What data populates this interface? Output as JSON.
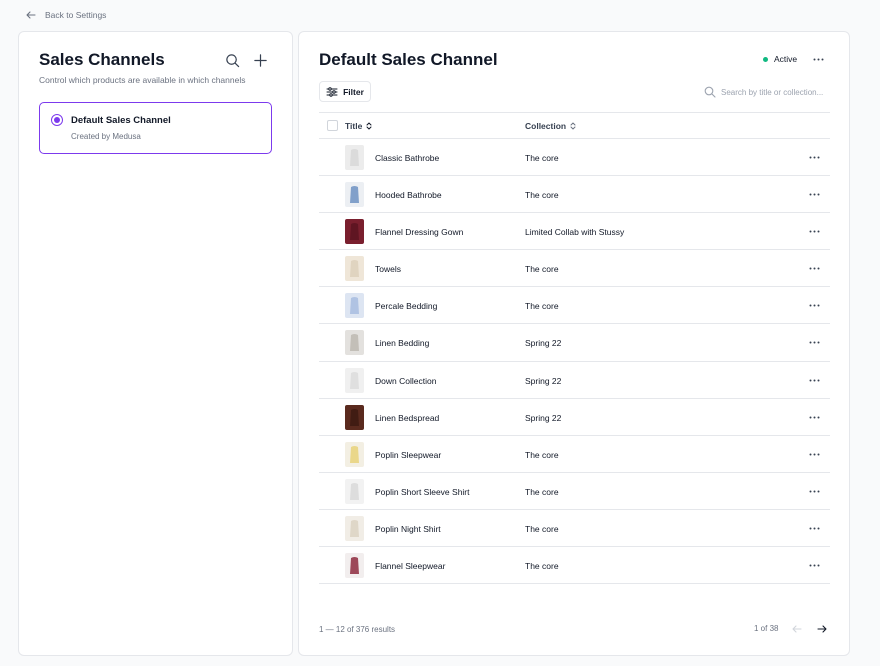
{
  "back_link": {
    "label": "Back to Settings"
  },
  "sidebar": {
    "title": "Sales Channels",
    "subtitle": "Control which products are available in which channels",
    "channels": [
      {
        "name": "Default Sales Channel",
        "meta": "Created by Medusa",
        "selected": true
      }
    ]
  },
  "main": {
    "title": "Default Sales Channel",
    "status": "Active",
    "filter_label": "Filter",
    "search_placeholder": "Search by title or collection...",
    "columns": {
      "title": "Title",
      "collection": "Collection"
    },
    "rows": [
      {
        "title": "Classic Bathrobe",
        "collection": "The core",
        "thumb": "white-robe"
      },
      {
        "title": "Hooded Bathrobe",
        "collection": "The core",
        "thumb": "blue-robe"
      },
      {
        "title": "Flannel Dressing Gown",
        "collection": "Limited Collab with Stussy",
        "thumb": "burgundy-gown"
      },
      {
        "title": "Towels",
        "collection": "The core",
        "thumb": "beige-towels"
      },
      {
        "title": "Percale Bedding",
        "collection": "The core",
        "thumb": "blue-bedding"
      },
      {
        "title": "Linen Bedding",
        "collection": "Spring 22",
        "thumb": "grey-linen"
      },
      {
        "title": "Down Collection",
        "collection": "Spring 22",
        "thumb": "white-down"
      },
      {
        "title": "Linen Bedspread",
        "collection": "Spring 22",
        "thumb": "brown-bedspread"
      },
      {
        "title": "Poplin Sleepwear",
        "collection": "The core",
        "thumb": "yellow-sleepwear"
      },
      {
        "title": "Poplin Short Sleeve Shirt",
        "collection": "The core",
        "thumb": "white-shirt"
      },
      {
        "title": "Poplin Night Shirt",
        "collection": "The core",
        "thumb": "cream-nightshirt"
      },
      {
        "title": "Flannel Sleepwear",
        "collection": "The core",
        "thumb": "red-sleepwear"
      }
    ],
    "footer": {
      "results": "1 — 12 of 376 results",
      "page": "1 of 38"
    }
  },
  "colors": {
    "accent": "#7c3aed",
    "status_active": "#10b981",
    "thumbs": {
      "white-robe": [
        "#ececec",
        "#d8d8d8"
      ],
      "blue-robe": [
        "#eceff3",
        "#6f92c2"
      ],
      "burgundy-gown": [
        "#7a1f2e",
        "#5a1420"
      ],
      "beige-towels": [
        "#efe6d8",
        "#ddd0bc"
      ],
      "blue-bedding": [
        "#dde5f2",
        "#a8bde0"
      ],
      "grey-linen": [
        "#e3e1de",
        "#bdb8b2"
      ],
      "white-down": [
        "#f0f0f0",
        "#dcdcdc"
      ],
      "brown-bedspread": [
        "#5a2a1e",
        "#3d1a12"
      ],
      "yellow-sleepwear": [
        "#f3efe3",
        "#e8d27a"
      ],
      "white-shirt": [
        "#f2f2f2",
        "#d9d9d9"
      ],
      "cream-nightshirt": [
        "#f1ede6",
        "#dcd2c2"
      ],
      "red-sleepwear": [
        "#f2eeee",
        "#8e2a3e"
      ]
    }
  }
}
